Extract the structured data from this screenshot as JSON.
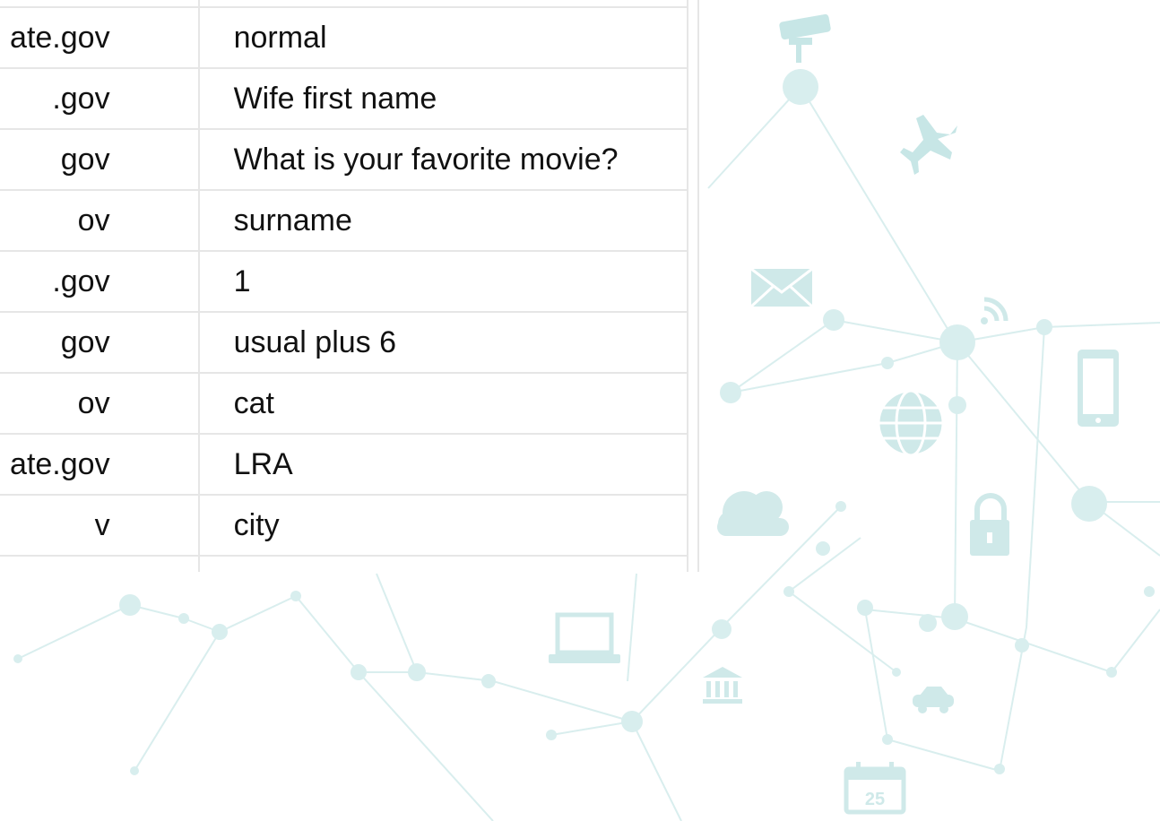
{
  "table": {
    "rows": [
      {
        "domain": "",
        "answer": ""
      },
      {
        "domain": "ate.gov",
        "answer": "normal"
      },
      {
        "domain": ".gov",
        "answer": "Wife first name"
      },
      {
        "domain": "gov",
        "answer": "What is your favorite movie?"
      },
      {
        "domain": "ov",
        "answer": "surname"
      },
      {
        "domain": ".gov",
        "answer": "1"
      },
      {
        "domain": "gov",
        "answer": "usual plus 6"
      },
      {
        "domain": "ov",
        "answer": "cat"
      },
      {
        "domain": "ate.gov",
        "answer": "LRA"
      },
      {
        "domain": "v",
        "answer": "city"
      },
      {
        "domain": "",
        "answer": ""
      }
    ]
  },
  "background": {
    "accent_color": "#bfe3e3",
    "line_color": "#d7eeee",
    "icons": [
      "security-camera-icon",
      "airplane-icon",
      "envelope-icon",
      "wifi-icon",
      "smartphone-icon",
      "globe-icon",
      "cloud-icon",
      "padlock-icon",
      "laptop-icon",
      "bank-icon",
      "car-icon",
      "calendar-icon"
    ],
    "calendar_day": "25"
  }
}
